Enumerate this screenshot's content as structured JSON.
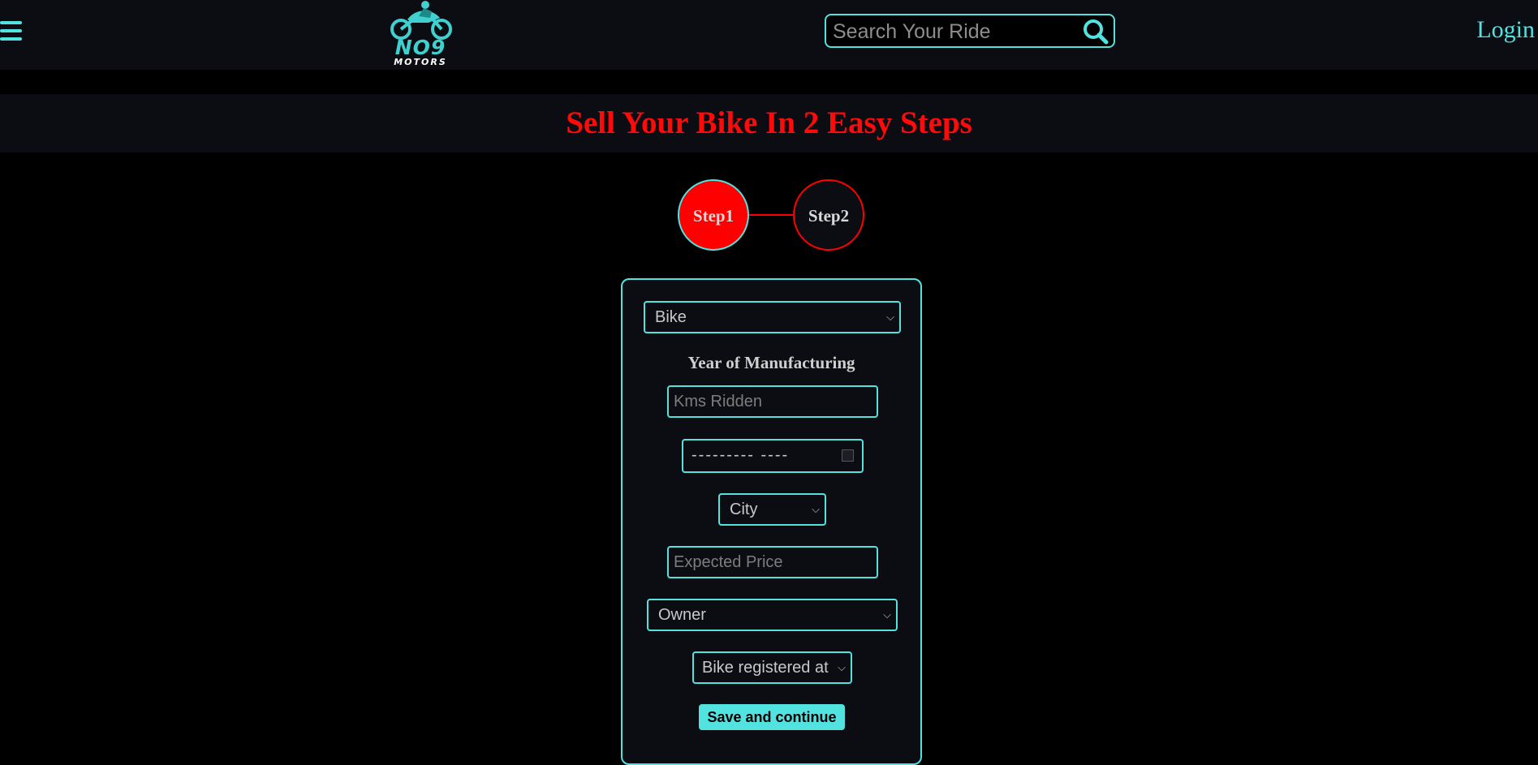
{
  "header": {
    "logo_title": "NO9",
    "logo_subtitle": "MOTORS",
    "search_placeholder": "Search Your Ride",
    "login_label": "Login"
  },
  "title": "Sell Your Bike In 2 Easy Steps",
  "steps": [
    {
      "label": "Step1",
      "active": true
    },
    {
      "label": "Step2",
      "active": false
    }
  ],
  "form": {
    "vehicle_type_selected": "Bike",
    "year_label": "Year of Manufacturing",
    "kms_placeholder": "Kms Ridden",
    "date_value": "---------  ----",
    "city_selected": "City",
    "price_placeholder": "Expected Price",
    "owner_selected": "Owner",
    "registered_selected": "Bike registered at",
    "save_label": "Save and continue"
  },
  "colors": {
    "accent": "#52e3e1",
    "title_red": "#ff0a0a",
    "step_active_bg": "#ff0000",
    "panel_bg": "#0b0d12",
    "page_bg": "#000000"
  }
}
